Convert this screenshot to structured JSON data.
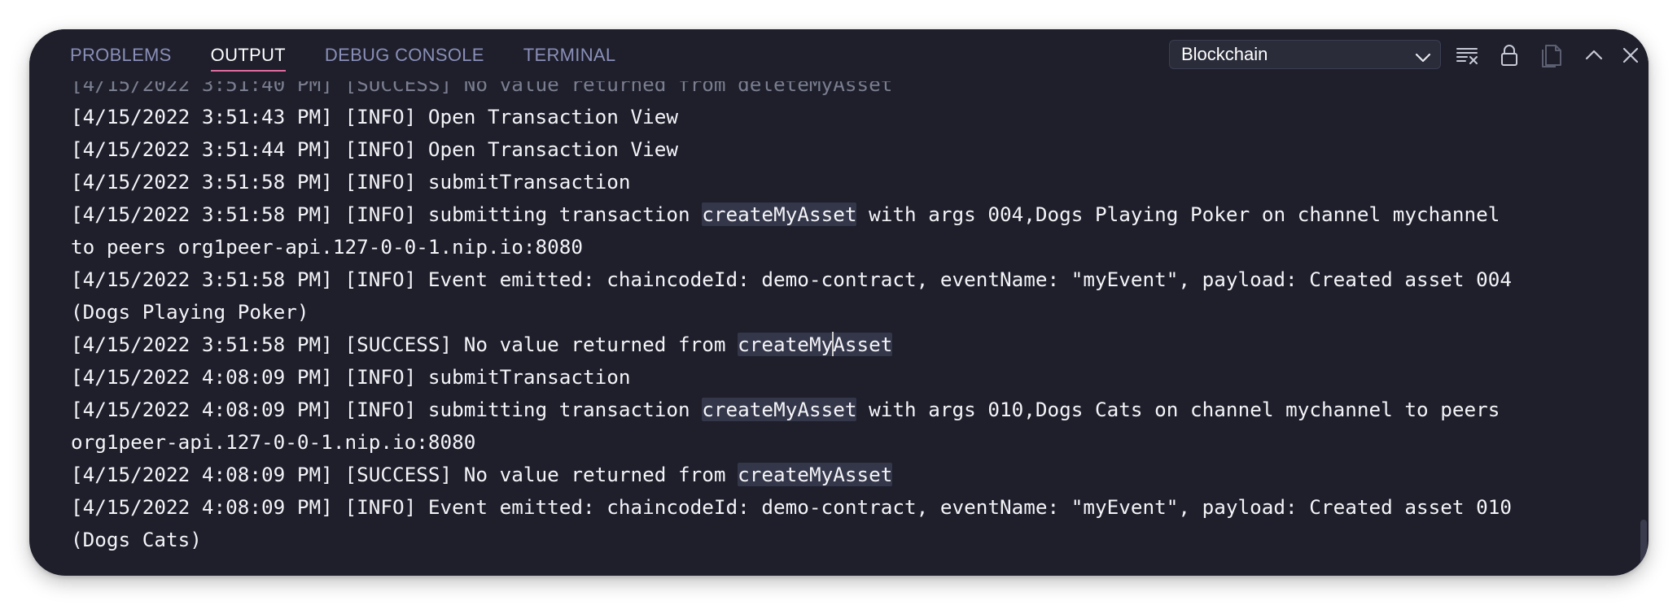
{
  "panel": {
    "tabs": [
      {
        "label": "PROBLEMS",
        "active": false
      },
      {
        "label": "OUTPUT",
        "active": true
      },
      {
        "label": "DEBUG CONSOLE",
        "active": false
      },
      {
        "label": "TERMINAL",
        "active": false
      }
    ],
    "channel_select": {
      "value": "Blockchain"
    },
    "toolbar_icons": [
      "clear-output-icon",
      "lock-icon",
      "open-in-editor-icon",
      "maximize-icon",
      "close-icon"
    ]
  },
  "output": {
    "lines": [
      {
        "text": "[4/15/2022 3:51:40 PM] [SUCCESS] No value returned from deleteMyAsset",
        "faded": true
      },
      {
        "text": "[4/15/2022 3:51:43 PM] [INFO] Open Transaction View"
      },
      {
        "text": "[4/15/2022 3:51:44 PM] [INFO] Open Transaction View"
      },
      {
        "text": "[4/15/2022 3:51:58 PM] [INFO] submitTransaction"
      },
      {
        "pre": "[4/15/2022 3:51:58 PM] [INFO] submitting transaction ",
        "hl": "createMyAsset",
        "post": " with args 004,Dogs Playing Poker on channel mychannel"
      },
      {
        "text": "to peers org1peer-api.127-0-0-1.nip.io:8080"
      },
      {
        "text": "[4/15/2022 3:51:58 PM] [INFO] Event emitted: chaincodeId: demo-contract, eventName: \"myEvent\", payload: Created asset 004"
      },
      {
        "text": "(Dogs Playing Poker)"
      },
      {
        "pre": "[4/15/2022 3:51:58 PM] [SUCCESS] No value returned from ",
        "hl": "createMyAsset",
        "post": "",
        "cursor_after": 8
      },
      {
        "text": "[4/15/2022 4:08:09 PM] [INFO] submitTransaction"
      },
      {
        "pre": "[4/15/2022 4:08:09 PM] [INFO] submitting transaction ",
        "hl": "createMyAsset",
        "post": " with args 010,Dogs Cats on channel mychannel to peers"
      },
      {
        "text": "org1peer-api.127-0-0-1.nip.io:8080"
      },
      {
        "pre": "[4/15/2022 4:08:09 PM] [SUCCESS] No value returned from ",
        "hl": "createMyAsset",
        "post": ""
      },
      {
        "text": "[4/15/2022 4:08:09 PM] [INFO] Event emitted: chaincodeId: demo-contract, eventName: \"myEvent\", payload: Created asset 010"
      },
      {
        "text": "(Dogs Cats)"
      }
    ]
  },
  "colors": {
    "background": "#1e1f2b",
    "tab_inactive": "#8a8fb8",
    "tab_active": "#ffffff",
    "tab_underline": "#e06c9f",
    "text": "#f4f4f8",
    "highlight": "#34374a"
  }
}
